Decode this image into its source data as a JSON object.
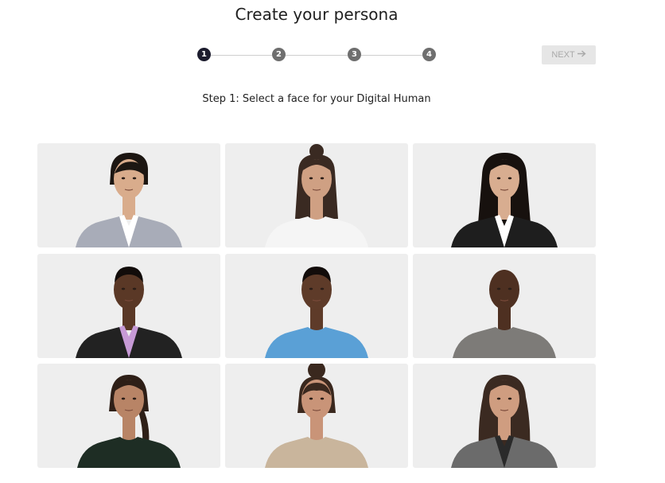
{
  "header": {
    "title": "Create your persona"
  },
  "stepper": {
    "steps": [
      {
        "label": "1",
        "state": "active"
      },
      {
        "label": "2",
        "state": "inactive"
      },
      {
        "label": "3",
        "state": "inactive"
      },
      {
        "label": "4",
        "state": "inactive"
      }
    ],
    "next_label": "NEXT",
    "next_icon": "arrow-right-icon"
  },
  "instruction": "Step 1: Select a face for your Digital Human",
  "faces": [
    {
      "id": "face-1",
      "skin": "#d9ac8c",
      "hair": "#1c1612",
      "hairStyle": "short-side",
      "top": "#a8acb8",
      "inner": "#ffffff",
      "jacket": true
    },
    {
      "id": "face-2",
      "skin": "#cfa083",
      "hair": "#3a2a22",
      "hairStyle": "bun-long",
      "top": "#f5f5f5",
      "inner": "#f5f5f5",
      "jacket": false
    },
    {
      "id": "face-3",
      "skin": "#d8ad90",
      "hair": "#17110e",
      "hairStyle": "long",
      "top": "#1e1e1e",
      "inner": "#ffffff",
      "jacket": true
    },
    {
      "id": "face-4",
      "skin": "#5a3826",
      "hair": "#120c0a",
      "hairStyle": "short",
      "top": "#222222",
      "inner": "#c79ad6",
      "jacket": true
    },
    {
      "id": "face-5",
      "skin": "#5e3b29",
      "hair": "#120c0a",
      "hairStyle": "short",
      "top": "#5aa0d6",
      "inner": "#5aa0d6",
      "jacket": false
    },
    {
      "id": "face-6",
      "skin": "#4e3021",
      "hair": "#4e3021",
      "hairStyle": "bald",
      "top": "#7d7b78",
      "inner": "#7d7b78",
      "jacket": false
    },
    {
      "id": "face-7",
      "skin": "#b88466",
      "hair": "#2e1f17",
      "hairStyle": "braid",
      "top": "#1e2d24",
      "inner": "#1e2d24",
      "jacket": false
    },
    {
      "id": "face-8",
      "skin": "#c99478",
      "hair": "#3a281e",
      "hairStyle": "bun-bangs",
      "top": "#c9b59c",
      "inner": "#d8c8b2",
      "jacket": false
    },
    {
      "id": "face-9",
      "skin": "#cf9d80",
      "hair": "#3b2a21",
      "hairStyle": "long-wavy",
      "top": "#6b6b6b",
      "inner": "#2a2a2a",
      "jacket": true
    }
  ],
  "colors": {
    "step_active": "#1c1c2e",
    "step_inactive": "#6f6f6f",
    "card_bg": "#eeeeee",
    "next_disabled_bg": "#e6e6e6",
    "next_disabled_text": "#a9a9a9"
  }
}
